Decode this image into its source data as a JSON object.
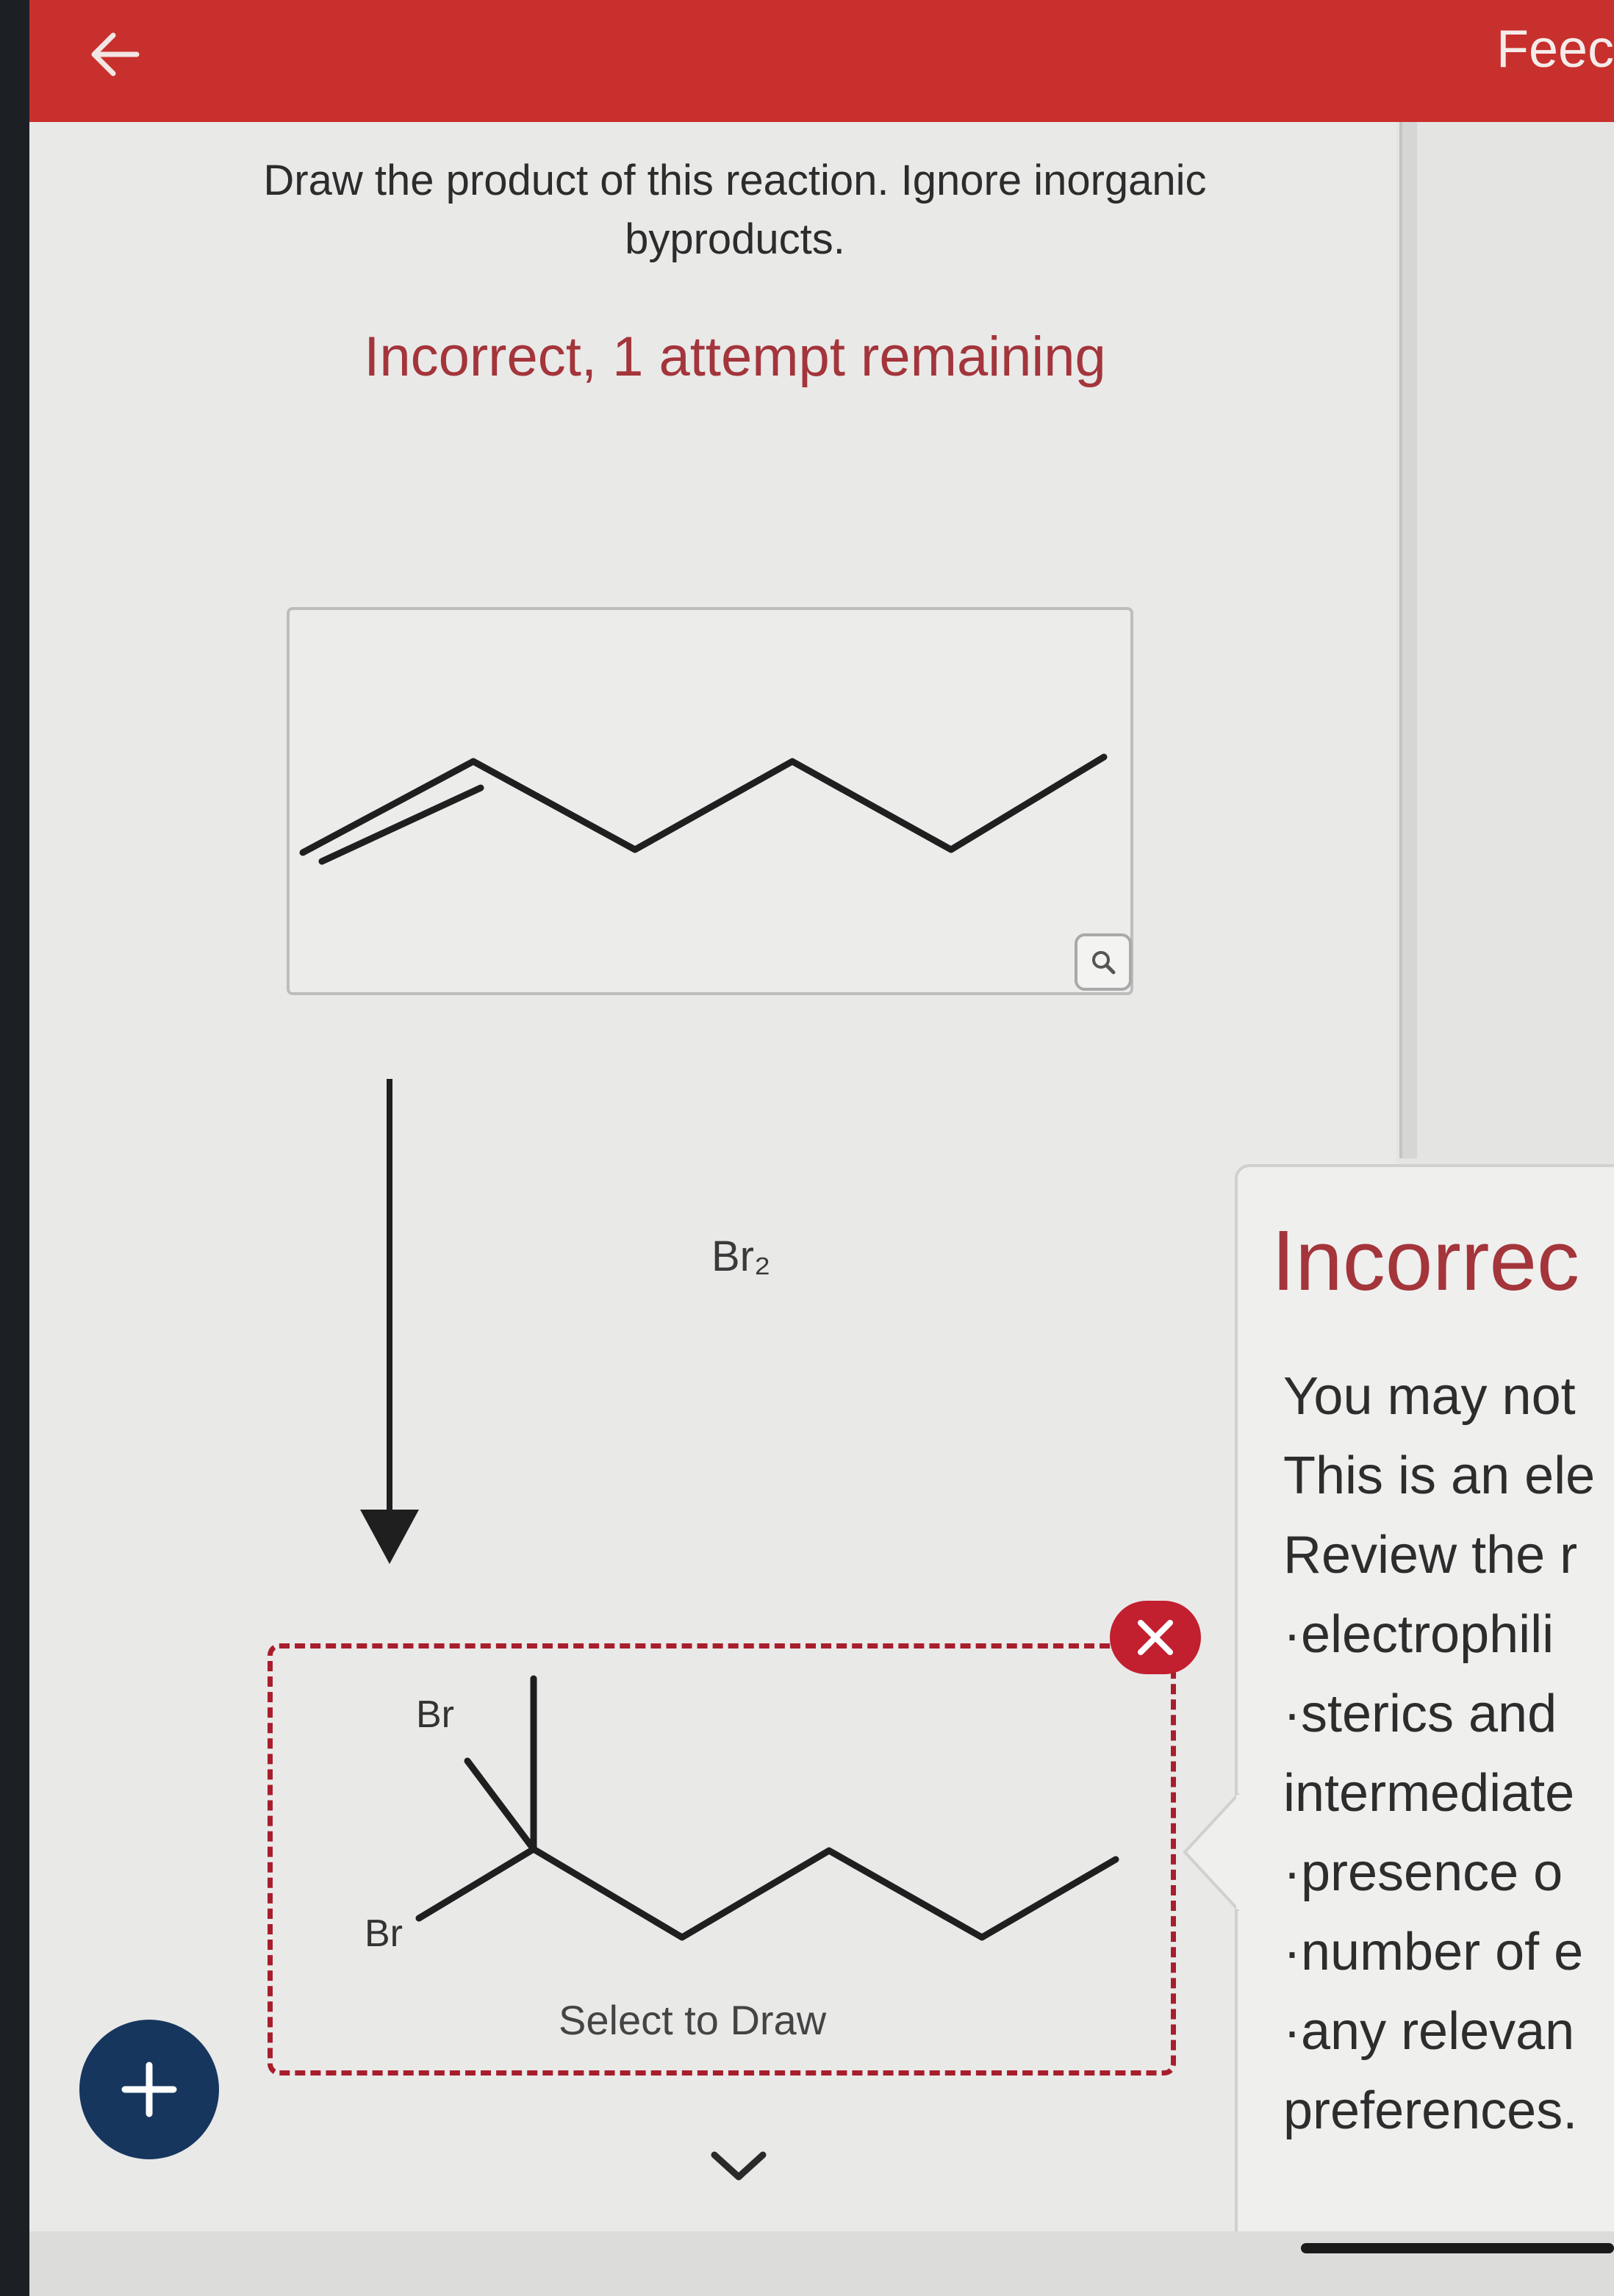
{
  "header": {
    "back_icon": "arrow-left-icon",
    "feedback_tab": "Feec"
  },
  "question": {
    "prompt": "Draw the product of this reaction. Ignore inorganic byproducts.",
    "status": "Incorrect, 1 attempt remaining",
    "reagent": "Br₂"
  },
  "answer": {
    "atom_label_top": "Br",
    "atom_label_bottom": "Br",
    "select_to_draw": "Select to Draw"
  },
  "feedback": {
    "title": "Incorrec",
    "lines": [
      "You may not",
      "This is an ele",
      "Review the r",
      "·electrophili",
      "·sterics and",
      "intermediate",
      "·presence o",
      "·number of e",
      "·any relevan",
      "preferences."
    ]
  },
  "colors": {
    "header_red": "#c8302d",
    "error_text": "#a3353b",
    "dashed_border": "#a81e2c",
    "add_button": "#16365e"
  }
}
